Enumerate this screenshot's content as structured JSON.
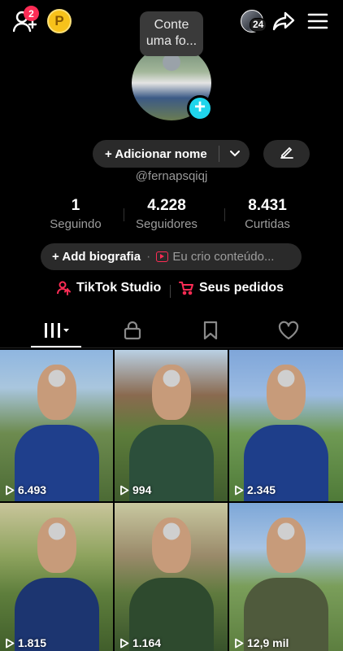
{
  "topbar": {
    "friend_requests_badge": "2",
    "coin_label": "P",
    "stories_count": "24",
    "icons": [
      "add-friend-icon",
      "coin-icon",
      "share-icon",
      "menu-icon"
    ]
  },
  "tooltip": {
    "line1": "Conte",
    "line2": "uma fo..."
  },
  "profile": {
    "add_name_label": "+ Adicionar nome",
    "username": "@fernapsqiqj",
    "stats": [
      {
        "value": "1",
        "label": "Seguindo"
      },
      {
        "value": "4.228",
        "label": "Seguidores"
      },
      {
        "value": "8.431",
        "label": "Curtidas"
      }
    ],
    "bio_add_label": "+ Add biografia",
    "bio_suggestion": "Eu crio conteúdo..."
  },
  "links": {
    "studio": "TikTok Studio",
    "orders": "Seus pedidos"
  },
  "colors": {
    "accent": "#fe2c55",
    "avatar_plus": "#20d5ec",
    "coin": "#f7c21b"
  },
  "videos": [
    {
      "views": "6.493",
      "bg": "linear-gradient(180deg,#8fb6e0 0%,#a9c6de 25%,#6d8b4f 55%,#4c6b35 100%)",
      "shirt": "#1f3f8c"
    },
    {
      "views": "994",
      "bg": "linear-gradient(180deg,#b9d0e4 0%,#8a6a4f 30%,#5d7d3b 55%,#3f5b2d 100%)",
      "shirt": "#2c4f3b"
    },
    {
      "views": "2.345",
      "bg": "linear-gradient(180deg,#7fa6d9 0%,#9bbbe2 30%,#6f9a54 55%,#4f7a38 100%)",
      "shirt": "#1e3e8a"
    },
    {
      "views": "1.815",
      "bg": "linear-gradient(180deg,#c9c59b 0%,#8ea35e 35%,#5e7e3c 60%,#3f5c2a 100%)",
      "shirt": "#1c3570"
    },
    {
      "views": "1.164",
      "bg": "linear-gradient(180deg,#c8c8a0 0%,#9a8a6a 35%,#5f7a3e 60%,#35502a 100%)",
      "shirt": "#2e4a2e"
    },
    {
      "views": "12,9 mil",
      "bg": "linear-gradient(180deg,#7da7d8 0%,#a8c4e4 30%,#7a9e5a 55%,#5b7d3e 100%)",
      "shirt": "#4f5a3c"
    }
  ]
}
